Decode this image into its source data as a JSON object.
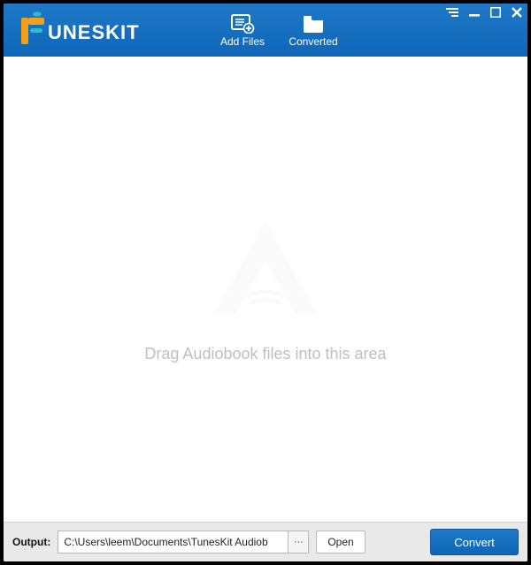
{
  "header": {
    "brand_text": "UNESKIT",
    "buttons": {
      "add_files": "Add Files",
      "converted": "Converted"
    }
  },
  "content": {
    "drag_hint": "Drag Audiobook files into this area"
  },
  "bottom": {
    "output_label": "Output:",
    "output_path": "C:\\Users\\leem\\Documents\\TunesKit Audiob",
    "browse_label": "···",
    "open_label": "Open",
    "convert_label": "Convert"
  }
}
